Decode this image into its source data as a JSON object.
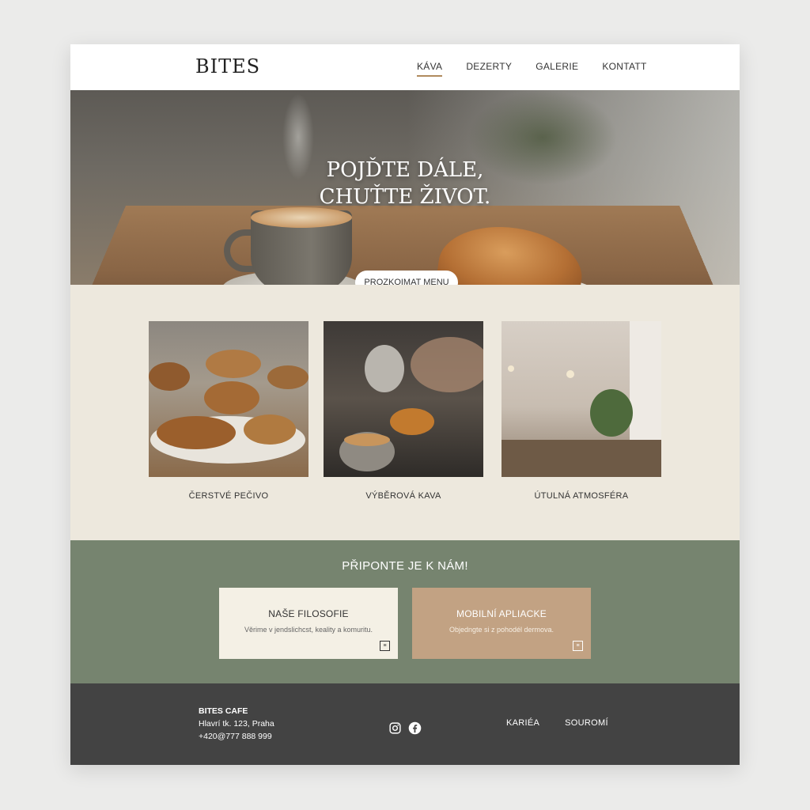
{
  "header": {
    "logo": "BITES",
    "nav": [
      "KÁVA",
      "DEZERTY",
      "GALERIE",
      "KONTATT"
    ],
    "active_nav": "KÁVA"
  },
  "hero": {
    "title_line1": "POJĎTE DÁLE,",
    "title_line2": "CHUŤTE ŽIVOT.",
    "button_label": "PROZKOIMAT MENU"
  },
  "features": [
    {
      "caption": "ČERSTVÉ PEČIVO",
      "image": "pastries-on-plates"
    },
    {
      "caption": "VÝBĚROVÁ KAVA",
      "image": "espresso-pour"
    },
    {
      "caption": "ÚTULNÁ ATMOSFÉRA",
      "image": "cafe-interior"
    }
  ],
  "join": {
    "title": "PŘIPONTE JE K NÁM!",
    "cards": [
      {
        "title": "NAŠE FILOSOFIE",
        "desc": "Věrime v jendslichcst, keality a komuritu.",
        "icon": "external-link-icon"
      },
      {
        "title": "MOBILNÍ APLIACKE",
        "desc": "Objedngte si z pohodél dermova.",
        "icon": "external-link-icon"
      }
    ]
  },
  "footer": {
    "brand": "BITES CAFE",
    "address": "Hlavrí tk. 123, Praha",
    "phone": "+420@777 888 999",
    "social": [
      "instagram-icon",
      "facebook-icon"
    ],
    "links": [
      "KARIÉA",
      "SOUROMÍ"
    ]
  },
  "colors": {
    "accent": "#b08a5e",
    "features_bg": "#ede8dd",
    "join_bg": "#76846f",
    "card_light": "#f4f0e5",
    "card_dark": "#c2a283",
    "footer_bg": "#434343"
  }
}
